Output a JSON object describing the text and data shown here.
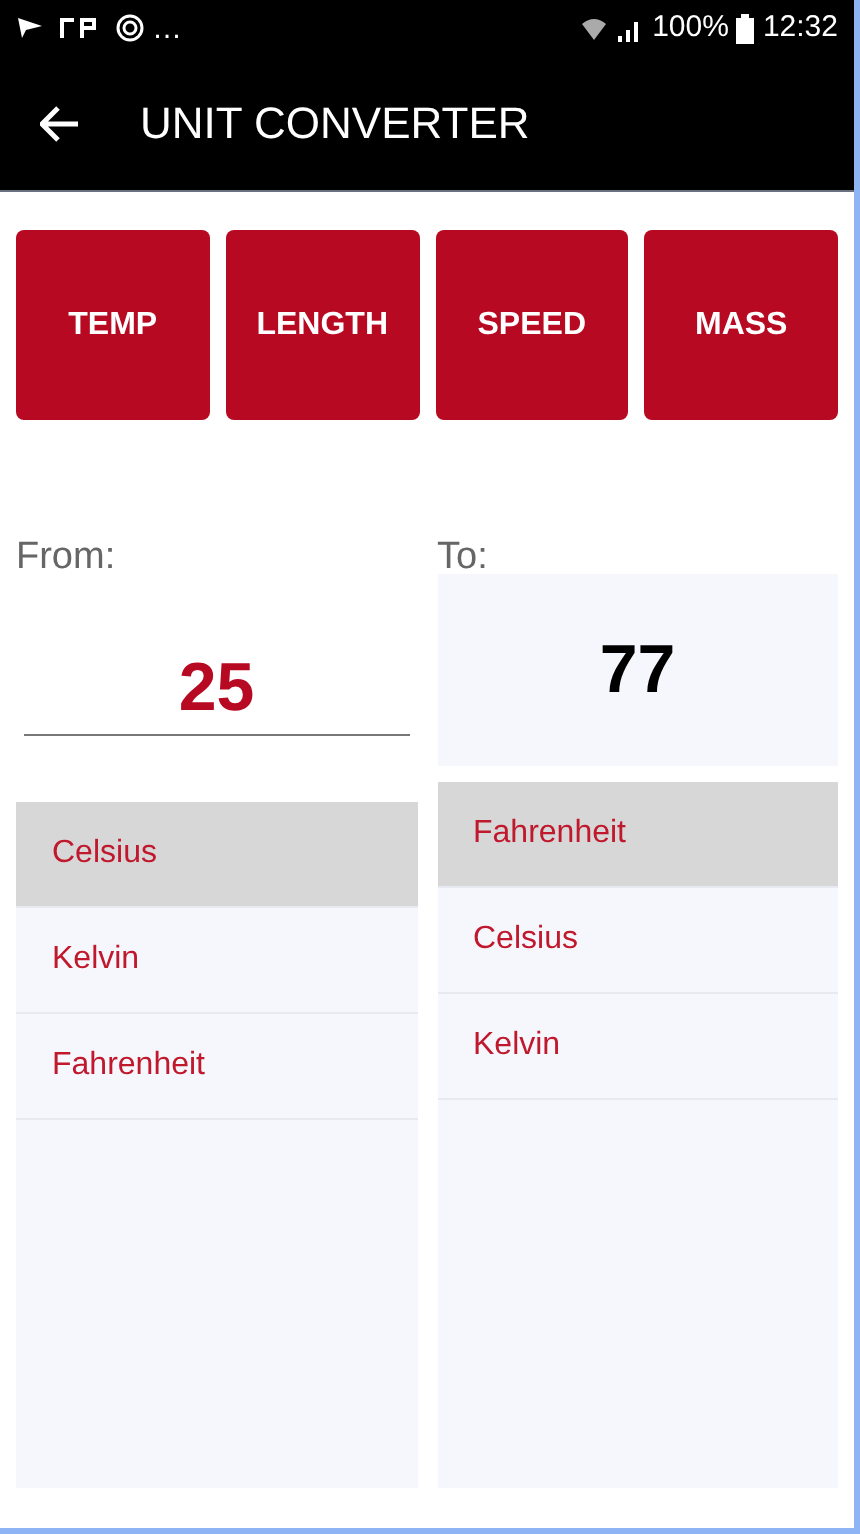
{
  "status_bar": {
    "overflow": "…",
    "battery": "100%",
    "time": "12:32"
  },
  "app_bar": {
    "title": "UNIT CONVERTER"
  },
  "categories": [
    {
      "label": "TEMP"
    },
    {
      "label": "LENGTH"
    },
    {
      "label": "SPEED"
    },
    {
      "label": "MASS"
    }
  ],
  "from": {
    "label": "From:",
    "value": "25",
    "units": [
      {
        "label": "Celsius",
        "selected": true
      },
      {
        "label": "Kelvin",
        "selected": false
      },
      {
        "label": "Fahrenheit",
        "selected": false
      }
    ]
  },
  "to": {
    "label": "To:",
    "value": "77",
    "units": [
      {
        "label": "Fahrenheit",
        "selected": true
      },
      {
        "label": "Celsius",
        "selected": false
      },
      {
        "label": "Kelvin",
        "selected": false
      }
    ]
  }
}
